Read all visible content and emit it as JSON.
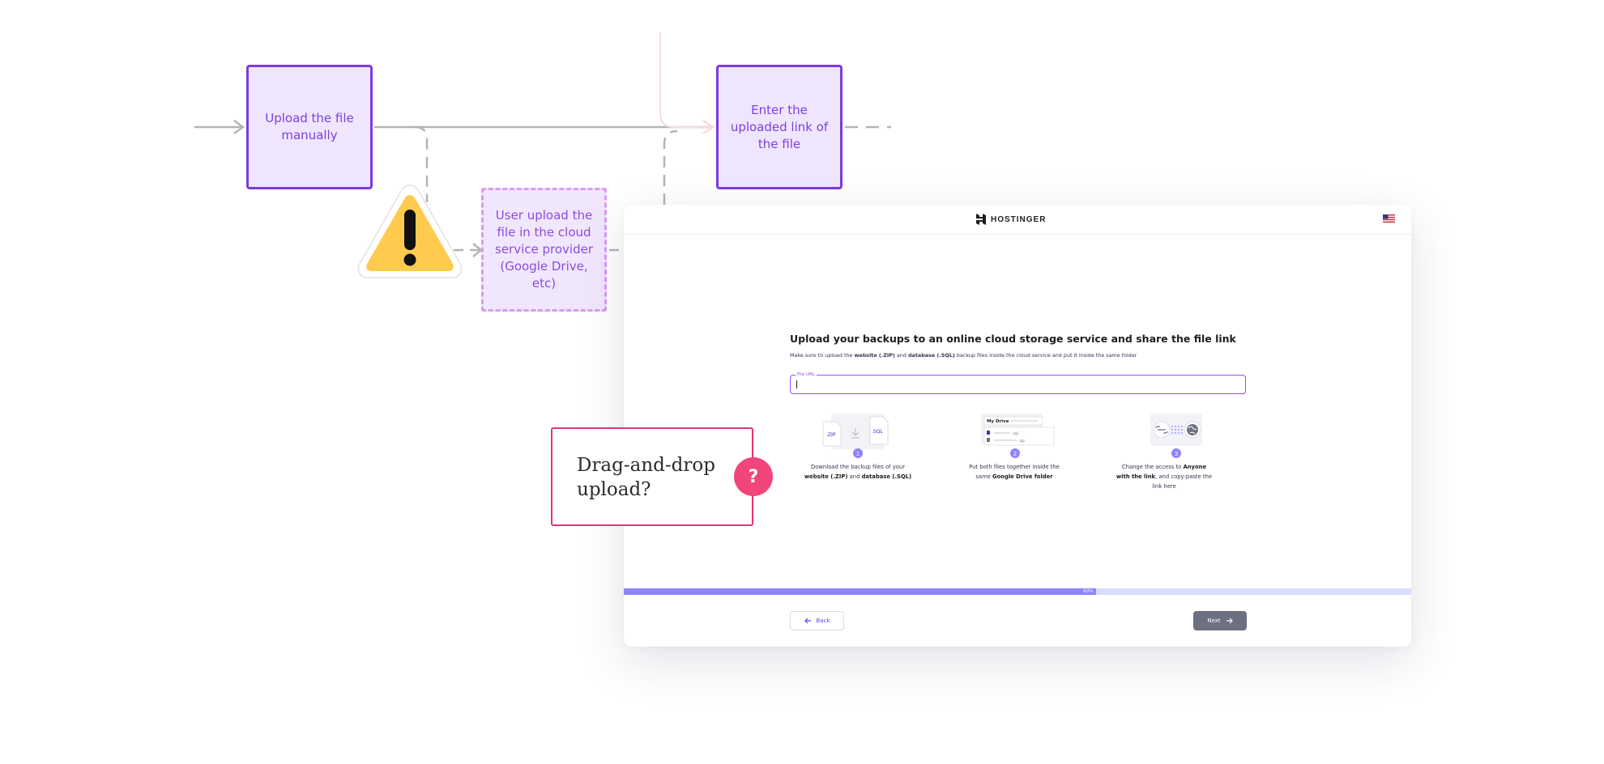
{
  "flow": {
    "box_manual": "Upload the file manually",
    "box_enter_link": "Enter the uploaded link of the file",
    "box_cloud": "User upload the file in the cloud service provider (Google Drive, etc)"
  },
  "mockup": {
    "logo": "HOSTINGER",
    "title": "Upload your backups to an online cloud storage service and share the file link",
    "subtitle": {
      "t1": "Make sure to upload the ",
      "b1": "website (.ZIP)",
      "t2": " and ",
      "b2": "database (.SQL)",
      "t3": " backup files inside the cloud service and put it inside the same folder"
    },
    "file_url_label": "File URL",
    "steps": [
      {
        "number": "1",
        "line1": "Download the backup files of your",
        "bold_a": "website (.ZIP)",
        "and": " and ",
        "bold_b": "database (.SQL)",
        "ill_a": ".ZIP",
        "ill_b": ".SQL"
      },
      {
        "number": "2",
        "line1": "Put both files together inside the",
        "pre": "same ",
        "bold": "Google Drive folder",
        "drive_label": "My Drive",
        "file_a": ".sql",
        "file_b": ".zip"
      },
      {
        "number": "3",
        "pre": "Change the access to ",
        "bold": "Anyone with the link",
        "post": ", and copy-paste the link here"
      }
    ],
    "progress_percent": 60,
    "progress_text": "60%",
    "back_label": "Back",
    "next_label": "Next"
  },
  "question": {
    "text": "Drag-and-drop upload?",
    "badge": "?"
  },
  "colors": {
    "flow_purple": "#7d3ae0",
    "flow_fill": "#efe6fd",
    "accent_pink": "#e7327a",
    "progress": "#8c85ff",
    "warning_yellow": "#fecb4f"
  }
}
